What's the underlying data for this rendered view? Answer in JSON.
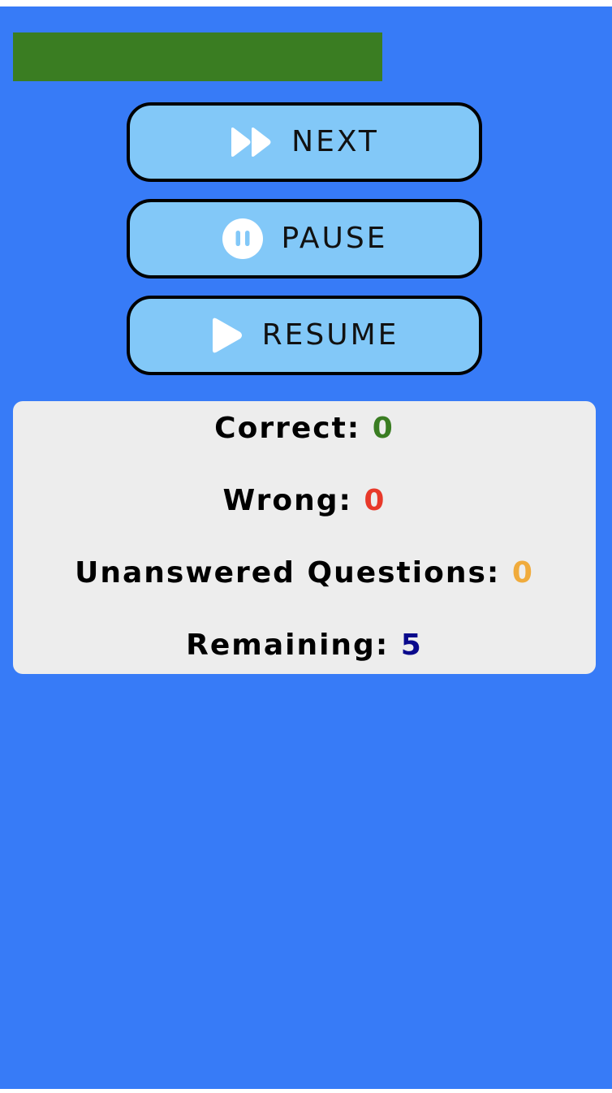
{
  "progress": {
    "color": "#3a7d22"
  },
  "controls": {
    "next": {
      "label": "NEXT",
      "icon": "fast-forward-icon"
    },
    "pause": {
      "label": "PAUSE",
      "icon": "pause-circle-icon"
    },
    "resume": {
      "label": "RESUME",
      "icon": "play-icon"
    }
  },
  "stats": {
    "correct": {
      "label": "Correct:",
      "value": "0",
      "color": "#3a7d22"
    },
    "wrong": {
      "label": "Wrong:",
      "value": "0",
      "color": "#e8392a"
    },
    "unanswered": {
      "label": "Unanswered Questions:",
      "value": "0",
      "color": "#f0ab3c"
    },
    "remaining": {
      "label": "Remaining:",
      "value": "5",
      "color": "#0a0a8c"
    }
  },
  "colors": {
    "background": "#377bf7",
    "button": "#82c8f8",
    "panel": "#ededed"
  }
}
